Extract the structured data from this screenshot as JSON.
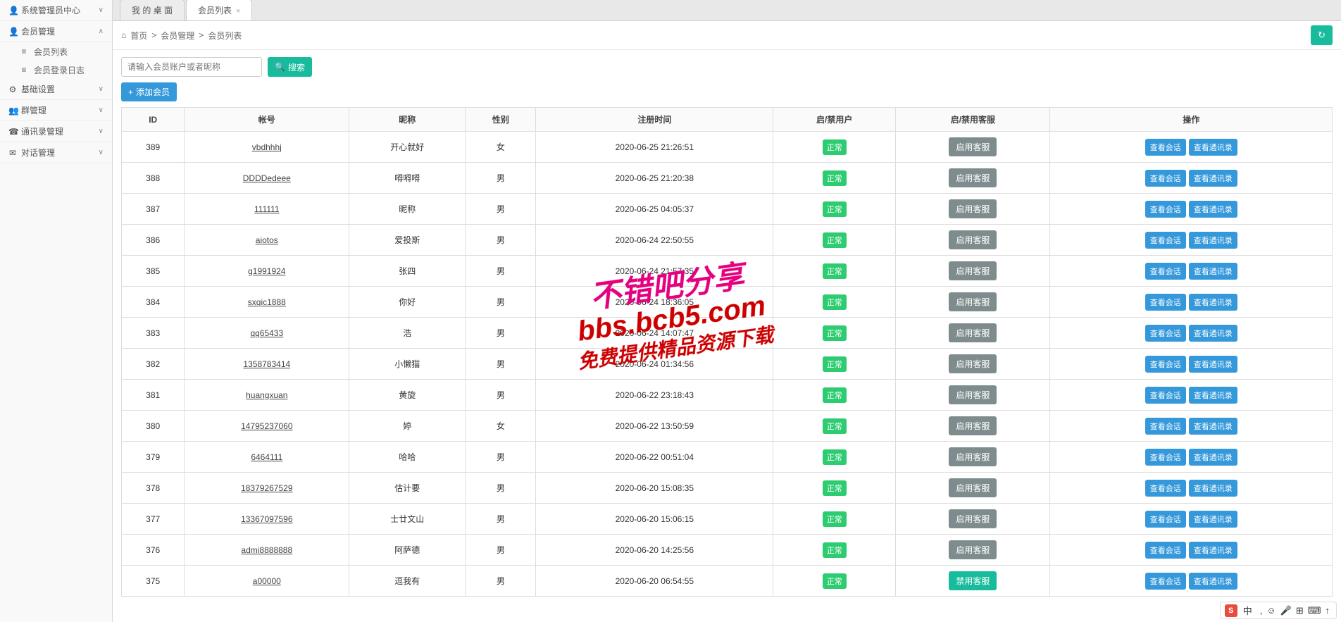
{
  "sidebar": {
    "items": [
      {
        "label": "系统管理员中心",
        "icon": "👤",
        "chev": "∨"
      },
      {
        "label": "会员管理",
        "icon": "👤",
        "chev": "∧",
        "subs": [
          {
            "label": "会员列表",
            "icon": "≡"
          },
          {
            "label": "会员登录日志",
            "icon": "≡"
          }
        ]
      },
      {
        "label": "基础设置",
        "icon": "⚙",
        "chev": "∨"
      },
      {
        "label": "群管理",
        "icon": "👥",
        "chev": "∨"
      },
      {
        "label": "通讯录管理",
        "icon": "☎",
        "chev": "∨"
      },
      {
        "label": "对话管理",
        "icon": "✉",
        "chev": "∨"
      }
    ]
  },
  "tabs": {
    "t0": "我 的 桌 面",
    "t1": "会员列表"
  },
  "breadcrumb": {
    "home": "首页",
    "sep": ">",
    "b1": "会员管理",
    "b2": "会员列表",
    "homeicon": "⌂"
  },
  "search": {
    "placeholder": "请输入会员账户或者昵称",
    "btn": "搜索",
    "icon": "🔍"
  },
  "add_btn": {
    "label": "添加会员",
    "icon": "+"
  },
  "table": {
    "headers": [
      "ID",
      "帐号",
      "昵称",
      "性别",
      "注册时间",
      "启/禁用户",
      "启/禁用客服",
      "操作"
    ],
    "status_normal": "正常",
    "btn_enable_cs": "启用客服",
    "btn_disable_cs": "禁用客服",
    "btn_view_chat": "查看会话",
    "btn_view_contacts": "查看通讯录",
    "rows": [
      {
        "id": "389",
        "acct": "vbdhhhj",
        "nick": "开心就好",
        "sex": "女",
        "reg": "2020-06-25 21:26:51",
        "cs": "enable"
      },
      {
        "id": "388",
        "acct": "DDDDedeee",
        "nick": "嘚嘚嘚",
        "sex": "男",
        "reg": "2020-06-25 21:20:38",
        "cs": "enable"
      },
      {
        "id": "387",
        "acct": "111111",
        "nick": "昵称",
        "sex": "男",
        "reg": "2020-06-25 04:05:37",
        "cs": "enable"
      },
      {
        "id": "386",
        "acct": "aiotos",
        "nick": "爱投斯",
        "sex": "男",
        "reg": "2020-06-24 22:50:55",
        "cs": "enable"
      },
      {
        "id": "385",
        "acct": "g1991924",
        "nick": "张四",
        "sex": "男",
        "reg": "2020-06-24 21:57:35",
        "cs": "enable"
      },
      {
        "id": "384",
        "acct": "sxqic1888",
        "nick": "你好",
        "sex": "男",
        "reg": "2020-06-24 18:36:05",
        "cs": "enable"
      },
      {
        "id": "383",
        "acct": "qq65433",
        "nick": "浩",
        "sex": "男",
        "reg": "2020-06-24 14:07:47",
        "cs": "enable"
      },
      {
        "id": "382",
        "acct": "1358783414",
        "nick": "小懒猫",
        "sex": "男",
        "reg": "2020-06-24 01:34:56",
        "cs": "enable"
      },
      {
        "id": "381",
        "acct": "huangxuan",
        "nick": "黄旋",
        "sex": "男",
        "reg": "2020-06-22 23:18:43",
        "cs": "enable"
      },
      {
        "id": "380",
        "acct": "14795237060",
        "nick": "婷",
        "sex": "女",
        "reg": "2020-06-22 13:50:59",
        "cs": "enable"
      },
      {
        "id": "379",
        "acct": "6464111",
        "nick": "哈哈",
        "sex": "男",
        "reg": "2020-06-22 00:51:04",
        "cs": "enable"
      },
      {
        "id": "378",
        "acct": "18379267529",
        "nick": "估计要",
        "sex": "男",
        "reg": "2020-06-20 15:08:35",
        "cs": "enable"
      },
      {
        "id": "377",
        "acct": "13367097596",
        "nick": "士廿文山",
        "sex": "男",
        "reg": "2020-06-20 15:06:15",
        "cs": "enable"
      },
      {
        "id": "376",
        "acct": "admi8888888",
        "nick": "阿萨德",
        "sex": "男",
        "reg": "2020-06-20 14:25:56",
        "cs": "enable"
      },
      {
        "id": "375",
        "acct": "a00000",
        "nick": "逗我有",
        "sex": "男",
        "reg": "2020-06-20 06:54:55",
        "cs": "disable"
      }
    ]
  },
  "watermark": {
    "l1": "不错吧分享",
    "l2": "bbs.bcb5.com",
    "l3": "免费提供精品资源下载"
  },
  "ime": {
    "brand": "S",
    "lang": "中",
    "items": [
      ",",
      "☺",
      "🎤",
      "⊞",
      "⌨",
      "↑"
    ]
  }
}
